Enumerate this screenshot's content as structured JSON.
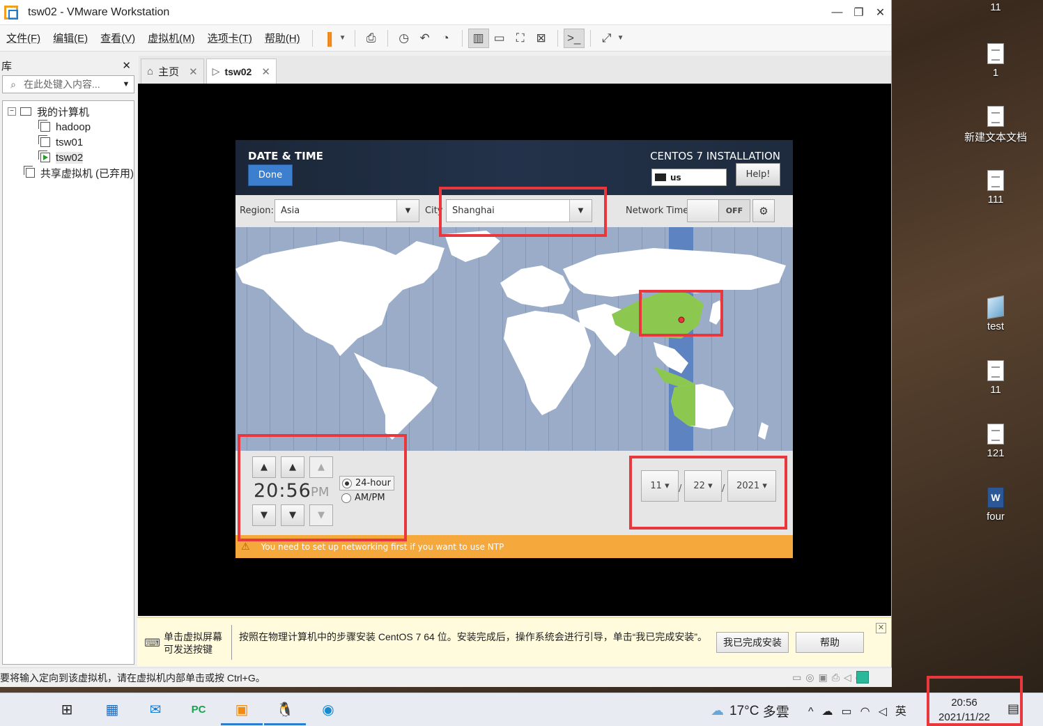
{
  "window": {
    "title": "tsw02 - VMware Workstation",
    "controls": {
      "minimize": "—",
      "restore": "❐",
      "close": "✕"
    }
  },
  "menu": [
    "文件(F)",
    "编辑(E)",
    "查看(V)",
    "虚拟机(M)",
    "选项卡(T)",
    "帮助(H)"
  ],
  "library": {
    "title": "库",
    "close": "✕",
    "search_placeholder": "在此处键入内容...",
    "tree": {
      "root": "我的计算机",
      "vms": [
        "hadoop",
        "tsw01",
        "tsw02"
      ],
      "shared": "共享虚拟机 (已弃用)"
    }
  },
  "tabs": [
    {
      "label": "主页",
      "close": "✕"
    },
    {
      "label": "tsw02",
      "close": "✕"
    }
  ],
  "installer": {
    "title": "DATE & TIME",
    "product": "CENTOS 7 INSTALLATION",
    "done_label": "Done",
    "keyboard": "us",
    "help_label": "Help!",
    "region_label": "Region:",
    "region_value": "Asia",
    "city_label": "City",
    "city_value": "Shanghai",
    "network_time_label": "Network Time",
    "network_time_state": "OFF",
    "time": "20:56",
    "ampm": "PM",
    "format_24": "24-hour",
    "format_ampm": "AM/PM",
    "date_month": "11",
    "date_day": "22",
    "date_year": "2021",
    "date_sep": "/",
    "warning": "You need to set up networking first if you want to use NTP"
  },
  "hint": {
    "left": "单击虚拟屏幕\n可发送按键",
    "text": "按照在物理计算机中的步骤安装 CentOS 7 64 位。安装完成后，操作系统会进行引导，单击“我已完成安装”。",
    "done_button": "我已完成安装",
    "help_button": "帮助",
    "close": "✕"
  },
  "statusbar": {
    "text": "要将输入定向到该虚拟机，请在虚拟机内部单击或按 Ctrl+G。"
  },
  "desktop_icons": [
    {
      "label": "11",
      "icon": "file-icon"
    },
    {
      "label": "1",
      "icon": "file-icon"
    },
    {
      "label": "新建文本文档",
      "icon": "file-icon"
    },
    {
      "label": "111",
      "icon": "file-icon"
    },
    {
      "label": "test",
      "icon": "app-icon"
    },
    {
      "label": "11",
      "icon": "file-icon"
    },
    {
      "label": "121",
      "icon": "file-icon"
    },
    {
      "label": "four",
      "icon": "word-doc-icon"
    }
  ],
  "taskbar": {
    "weather_temp": "17°C",
    "weather_text": "多雲",
    "ime": "英",
    "time": "20:56",
    "date": "2021/11/22"
  },
  "colors": {
    "highlight": "#e8383d",
    "done_button": "#3d7fcf",
    "warning_bar": "#f5a83c",
    "map_ocean": "#9aacc8",
    "map_selected_zone": "#5d84c0",
    "land_selected": "#8cc850"
  }
}
